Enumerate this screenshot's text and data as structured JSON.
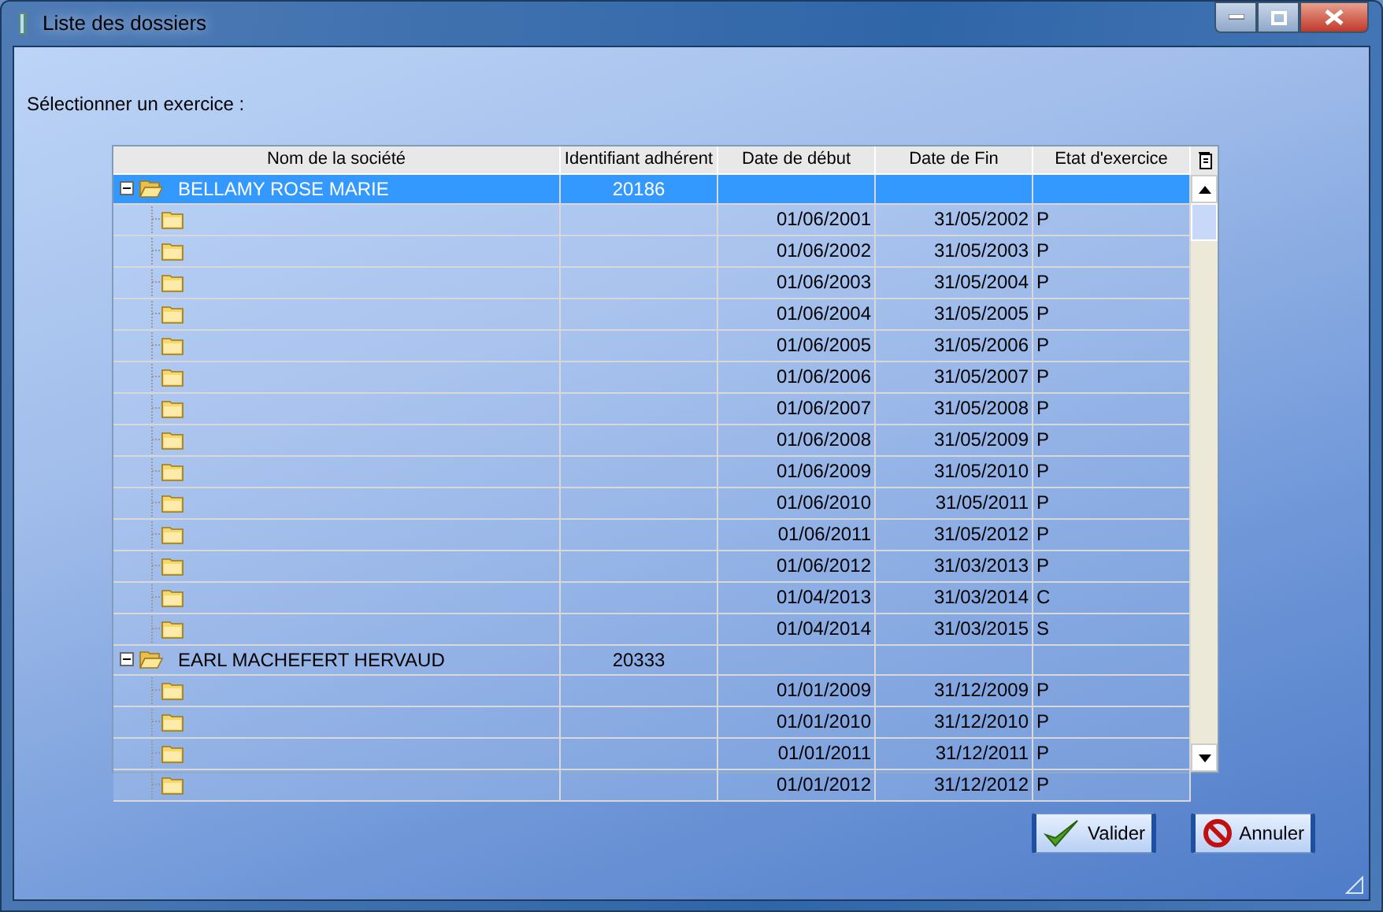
{
  "window": {
    "title": "Liste des dossiers"
  },
  "prompt": "Sélectionner un exercice :",
  "table": {
    "columns": [
      "Nom de la société",
      "Identifiant adhérent",
      "Date de début",
      "Date de Fin",
      "Etat d'exercice"
    ],
    "rows": [
      {
        "name": "BELLAMY ROSE MARIE",
        "id": "20186",
        "expanded": true,
        "selected": true,
        "children": [
          {
            "start": "01/06/2001",
            "end": "31/05/2002",
            "state": "P",
            "selected": false
          },
          {
            "start": "01/06/2002",
            "end": "31/05/2003",
            "state": "P",
            "selected": false
          },
          {
            "start": "01/06/2003",
            "end": "31/05/2004",
            "state": "P",
            "selected": false
          },
          {
            "start": "01/06/2004",
            "end": "31/05/2005",
            "state": "P",
            "selected": false
          },
          {
            "start": "01/06/2005",
            "end": "31/05/2006",
            "state": "P",
            "selected": false
          },
          {
            "start": "01/06/2006",
            "end": "31/05/2007",
            "state": "P",
            "selected": false
          },
          {
            "start": "01/06/2007",
            "end": "31/05/2008",
            "state": "P",
            "selected": false
          },
          {
            "start": "01/06/2008",
            "end": "31/05/2009",
            "state": "P",
            "selected": false
          },
          {
            "start": "01/06/2009",
            "end": "31/05/2010",
            "state": "P",
            "selected": false
          },
          {
            "start": "01/06/2010",
            "end": "31/05/2011",
            "state": "P",
            "selected": false
          },
          {
            "start": "01/06/2011",
            "end": "31/05/2012",
            "state": "P",
            "selected": false
          },
          {
            "start": "01/06/2012",
            "end": "31/03/2013",
            "state": "P",
            "selected": false
          },
          {
            "start": "01/04/2013",
            "end": "31/03/2014",
            "state": "C",
            "selected": false
          },
          {
            "start": "01/04/2014",
            "end": "31/03/2015",
            "state": "S",
            "selected": false
          }
        ]
      },
      {
        "name": "EARL MACHEFERT HERVAUD",
        "id": "20333",
        "expanded": true,
        "selected": false,
        "children": [
          {
            "start": "01/01/2009",
            "end": "31/12/2009",
            "state": "P",
            "selected": false
          },
          {
            "start": "01/01/2010",
            "end": "31/12/2010",
            "state": "P",
            "selected": false
          },
          {
            "start": "01/01/2011",
            "end": "31/12/2011",
            "state": "P",
            "selected": false
          },
          {
            "start": "01/01/2012",
            "end": "31/12/2012",
            "state": "P",
            "selected": false
          }
        ]
      }
    ]
  },
  "buttons": [
    {
      "kind": "ok",
      "label": "Valider"
    },
    {
      "kind": "cancel",
      "label": "Annuler"
    }
  ]
}
